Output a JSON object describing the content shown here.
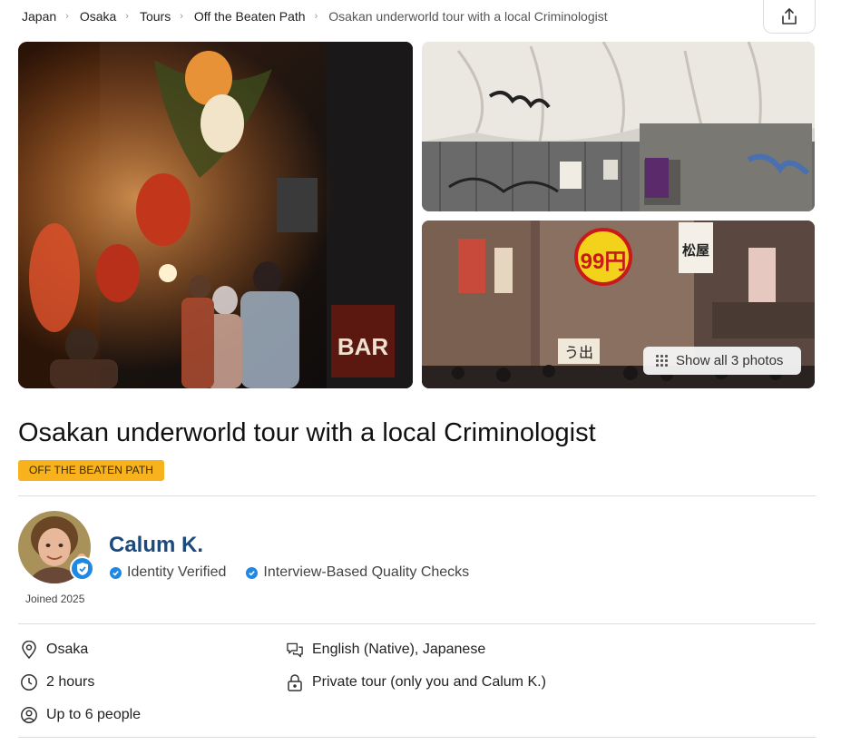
{
  "breadcrumb": [
    {
      "label": "Japan"
    },
    {
      "label": "Osaka"
    },
    {
      "label": "Tours"
    },
    {
      "label": "Off the Beaten Path"
    },
    {
      "label": "Osakan underworld tour with a local Criminologist"
    }
  ],
  "gallery": {
    "show_all_label": "Show all 3 photos",
    "signs": {
      "bar": "BAR",
      "price": "99円",
      "shop": "松屋",
      "exit": "う出"
    }
  },
  "tour": {
    "title": "Osakan underworld tour with a local Criminologist",
    "category_badge": "OFF THE BEATEN PATH"
  },
  "host": {
    "name": "Calum K.",
    "joined": "Joined 2025",
    "checks": [
      "Identity Verified",
      "Interview-Based Quality Checks"
    ]
  },
  "facts": {
    "location": "Osaka",
    "language": "English (Native), Japanese",
    "duration": "2 hours",
    "privacy": "Private tour (only you and Calum K.)",
    "group_size": "Up to 6 people"
  },
  "colors": {
    "badge": "#f7b21e",
    "host_name": "#1c4a7e",
    "verified": "#1e88e5"
  },
  "icons": [
    "chevron-right-icon",
    "share-icon",
    "grid-icon",
    "verified-badge-icon",
    "check-icon",
    "location-pin-icon",
    "chat-bubbles-icon",
    "clock-icon",
    "lock-icon",
    "person-circle-icon"
  ]
}
